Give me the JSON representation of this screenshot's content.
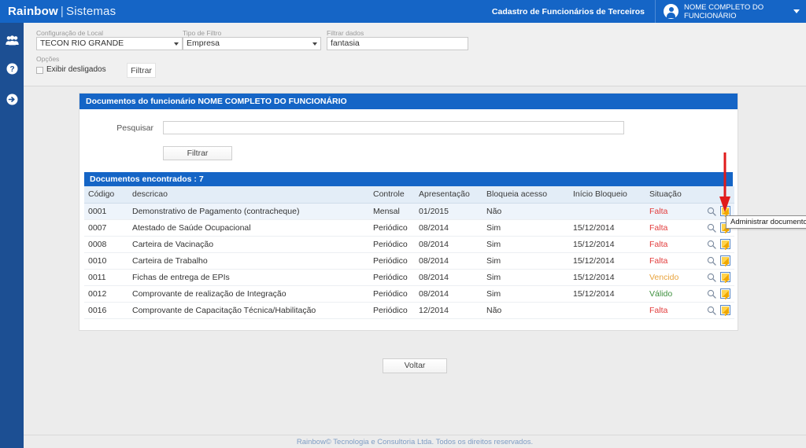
{
  "topbar": {
    "brand_name": "Rainbow",
    "brand_separator": "|",
    "brand_system": "Sistemas",
    "module_title": "Cadastro de Funcionários de Terceiros",
    "user_name": "NOME COMPLETO DO\nFUNCIONÁRIO"
  },
  "sidebar": {
    "items": [
      {
        "icon": "users-group-icon"
      },
      {
        "icon": "help-question-icon"
      },
      {
        "icon": "arrow-right-circle-icon"
      }
    ]
  },
  "filterbar": {
    "local_label": "Configuração de Local",
    "local_value": "TECON RIO GRANDE",
    "tipo_label": "Tipo de Filtro",
    "tipo_value": "Empresa",
    "dados_label": "Filtrar dados",
    "dados_value": "fantasia",
    "opcoes_label": "Opções",
    "checkbox_label": "Exibir desligados",
    "checkbox_checked": false,
    "filtrar_button": "Filtrar"
  },
  "panel": {
    "title": "Documentos do funcionário NOME COMPLETO DO FUNCIONÁRIO",
    "search_label": "Pesquisar",
    "search_value": "",
    "search_placeholder": "",
    "filter_button": "Filtrar",
    "results_title": "Documentos encontrados : 7"
  },
  "table": {
    "columns": [
      "Código",
      "descricao",
      "Controle",
      "Apresentação",
      "Bloqueia acesso",
      "Início Bloqueio",
      "Situação",
      ""
    ],
    "rows": [
      {
        "codigo": "0001",
        "descricao": "Demonstrativo de Pagamento (contracheque)",
        "controle": "Mensal",
        "apresentacao": "01/2015",
        "bloqueia": "Não",
        "inicio": "",
        "situacao": "Falta",
        "situacao_state": "falta",
        "highlight": true
      },
      {
        "codigo": "0007",
        "descricao": "Atestado de Saúde Ocupacional",
        "controle": "Periódico",
        "apresentacao": "08/2014",
        "bloqueia": "Sim",
        "inicio": "15/12/2014",
        "situacao": "Falta",
        "situacao_state": "falta",
        "highlight": false
      },
      {
        "codigo": "0008",
        "descricao": "Carteira de Vacinação",
        "controle": "Periódico",
        "apresentacao": "08/2014",
        "bloqueia": "Sim",
        "inicio": "15/12/2014",
        "situacao": "Falta",
        "situacao_state": "falta",
        "highlight": false
      },
      {
        "codigo": "0010",
        "descricao": "Carteira de Trabalho",
        "controle": "Periódico",
        "apresentacao": "08/2014",
        "bloqueia": "Sim",
        "inicio": "15/12/2014",
        "situacao": "Falta",
        "situacao_state": "falta",
        "highlight": false
      },
      {
        "codigo": "0011",
        "descricao": "Fichas de entrega de EPIs",
        "controle": "Periódico",
        "apresentacao": "08/2014",
        "bloqueia": "Sim",
        "inicio": "15/12/2014",
        "situacao": "Vencido",
        "situacao_state": "vencido",
        "highlight": false
      },
      {
        "codigo": "0012",
        "descricao": "Comprovante de realização de Integração",
        "controle": "Periódico",
        "apresentacao": "08/2014",
        "bloqueia": "Sim",
        "inicio": "15/12/2014",
        "situacao": "Válido",
        "situacao_state": "valido",
        "highlight": false
      },
      {
        "codigo": "0016",
        "descricao": "Comprovante de Capacitação Técnica/Habilitação",
        "controle": "Periódico",
        "apresentacao": "12/2014",
        "bloqueia": "Não",
        "inicio": "",
        "situacao": "Falta",
        "situacao_state": "falta",
        "highlight": false
      }
    ],
    "row_actions": {
      "view_icon": "magnifier-icon",
      "edit_icon": "edit-pencil-icon"
    }
  },
  "actions": {
    "back_button": "Voltar"
  },
  "annotation": {
    "tooltip_text": "Administrar documento",
    "arrow_color": "#e01b1b"
  },
  "footer": {
    "text": "Rainbow© Tecnologia e Consultoria Ltda. Todos os direitos reservados."
  },
  "colors": {
    "header_blue": "#1565c6",
    "sidebar_blue": "#1c4f93",
    "page_bg": "#ececec",
    "status_falta": "#e23b3b",
    "status_vencido": "#e8a33d",
    "status_valido": "#3c8f3c"
  }
}
